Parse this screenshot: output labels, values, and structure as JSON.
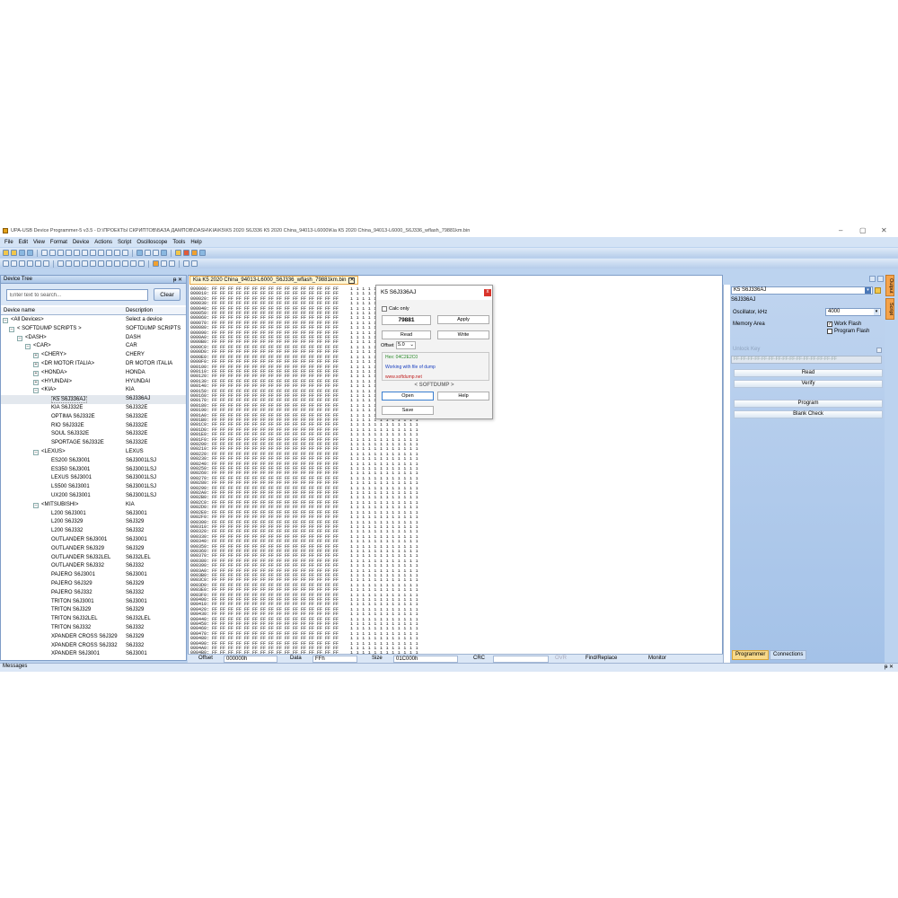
{
  "window": {
    "title": "UPA-USB Device Programmer-5 v3.5 - D:\\ПРОЕКТЫ СКРИПТОВ\\БАЗА ДАМПОВ\\DASH\\KIA\\K5\\K5 2020 S6J336 K5 2020 China_94013-L6000\\Kia K5 2020 China_94013-L6000_S6J336_wflash_79881km.bin",
    "minimize": "–",
    "maximize": "▢",
    "close": "✕"
  },
  "menu": [
    "File",
    "Edit",
    "View",
    "Format",
    "Device",
    "Actions",
    "Script",
    "Oscilloscope",
    "Tools",
    "Help"
  ],
  "device_tree": {
    "title": "Device Tree",
    "pin": "ᵽ ✕",
    "search_placeholder": "Enter text to search...",
    "clear_label": "Clear",
    "col_name": "Device name",
    "col_desc": "Description",
    "rows": [
      {
        "name": "<All Devices>",
        "desc": "Select a device",
        "expander": "–"
      },
      {
        "name": "< SOFTDUMP SCRIPTS >",
        "desc": "SOFTDUMP SCRIPTS",
        "expander": "–"
      },
      {
        "name": "<DASH>",
        "desc": "DASH",
        "expander": "–"
      },
      {
        "name": "<CAR>",
        "desc": "CAR",
        "expander": "–"
      },
      {
        "name": "<CHERY>",
        "desc": "CHERY",
        "expander": "+"
      },
      {
        "name": "<DR MOTOR ITALIA>",
        "desc": "DR MOTOR ITALIA",
        "expander": "+"
      },
      {
        "name": "<HONDA>",
        "desc": "HONDA",
        "expander": "+"
      },
      {
        "name": "<HYUNDAI>",
        "desc": "HYUNDAI",
        "expander": "+"
      },
      {
        "name": "<KIA>",
        "desc": "KIA",
        "expander": "–"
      },
      {
        "name": "K5 S6J336AJ",
        "desc": "S6J336AJ",
        "expander": ""
      },
      {
        "name": "KIA S6J332E",
        "desc": "S6J332E",
        "expander": ""
      },
      {
        "name": "OPTIMA S6J332E",
        "desc": "S6J332E",
        "expander": ""
      },
      {
        "name": "RIO S6J332E",
        "desc": "S6J332E",
        "expander": ""
      },
      {
        "name": "SOUL S6J332E",
        "desc": "S6J332E",
        "expander": ""
      },
      {
        "name": "SPORTAGE S6J332E",
        "desc": "S6J332E",
        "expander": ""
      },
      {
        "name": "<LEXUS>",
        "desc": "LEXUS",
        "expander": "–"
      },
      {
        "name": "ES200 S6J3001",
        "desc": "S6J3001LSJ",
        "expander": ""
      },
      {
        "name": "ES350 S6J3001",
        "desc": "S6J3001LSJ",
        "expander": ""
      },
      {
        "name": "LEXUS S6J3001",
        "desc": "S6J3001LSJ",
        "expander": ""
      },
      {
        "name": "LS500 S6J3001",
        "desc": "S6J3001LSJ",
        "expander": ""
      },
      {
        "name": "UX200 S6J3001",
        "desc": "S6J3001LSJ",
        "expander": ""
      },
      {
        "name": "<MITSUBISHI>",
        "desc": "KIA",
        "expander": "–"
      },
      {
        "name": "L200 S6J3001",
        "desc": "S6J3001",
        "expander": ""
      },
      {
        "name": "L200 S6J329",
        "desc": "S6J329",
        "expander": ""
      },
      {
        "name": "L200 S6J332",
        "desc": "S6J332",
        "expander": ""
      },
      {
        "name": "OUTLANDER S6J3001",
        "desc": "S6J3001",
        "expander": ""
      },
      {
        "name": "OUTLANDER S6J329",
        "desc": "S6J329",
        "expander": ""
      },
      {
        "name": "OUTLANDER S6J32LEL",
        "desc": "S6J32LEL",
        "expander": ""
      },
      {
        "name": "OUTLANDER S6J332",
        "desc": "S6J332",
        "expander": ""
      },
      {
        "name": "PAJERO S6J3001",
        "desc": "S6J3001",
        "expander": ""
      },
      {
        "name": "PAJERO S6J329",
        "desc": "S6J329",
        "expander": ""
      },
      {
        "name": "PAJERO S6J332",
        "desc": "S6J332",
        "expander": ""
      },
      {
        "name": "TRITON S6J3001",
        "desc": "S6J3001",
        "expander": ""
      },
      {
        "name": "TRITON S6J329",
        "desc": "S6J329",
        "expander": ""
      },
      {
        "name": "TRITON S6J32LEL",
        "desc": "S6J32LEL",
        "expander": ""
      },
      {
        "name": "TRITON S6J332",
        "desc": "S6J332",
        "expander": ""
      },
      {
        "name": "XPANDER CROSS S6J329",
        "desc": "S6J329",
        "expander": ""
      },
      {
        "name": "XPANDER CROSS S6J332",
        "desc": "S6J332",
        "expander": ""
      },
      {
        "name": "XPANDER S6J3001",
        "desc": "S6J3001",
        "expander": ""
      }
    ]
  },
  "hex_view": {
    "tab_label": "Kia K5 2020 China_94013-L6000_S6J336_wflash_79881km.bin",
    "tab_close": "✕",
    "fill_byte": "FF",
    "ascii_char": "ı"
  },
  "dialog": {
    "title": "K5 S6J336AJ",
    "close": "x",
    "calc_only": "Calc only",
    "value": "79881",
    "apply": "Apply",
    "read": "Read",
    "write": "Write",
    "offset_label": "Offset",
    "offset_value": "5.0",
    "hex_info": "Hex: 04C2E2C0",
    "working_info": "Working with file of dump",
    "url": "www.softdump.net",
    "brand": "< SOFTDUMP >",
    "open": "Open",
    "help": "Help",
    "save": "Save"
  },
  "status": {
    "offset_label": "Offset",
    "offset_value": "000000h",
    "data_label": "Data",
    "data_value": "FFh",
    "size_label": "Size",
    "size_value": "01C000h",
    "crc_label": "CRC",
    "crc_value": "",
    "ovr": "OVR",
    "find_replace": "Find/Replace",
    "monitor": "Monitor"
  },
  "programmer": {
    "device": "K5 S6J336AJ",
    "chip": "S6J336AJ",
    "oscillator_label": "Oscillator, kHz",
    "oscillator_value": "4000",
    "memory_area_label": "Memory Area",
    "work_flash": "Work Flash",
    "program_flash": "Program Flash",
    "unlock_key_label": "Unlock Key",
    "unlock_key_value": "FF-FF-FF-FF-FF-FF-FF-FF-FF-FF-FF-FF-FF-FF-FF",
    "read": "Read",
    "verify": "Verify",
    "program": "Program",
    "blank_check": "Blank Check",
    "tab_programmer": "Programmer",
    "tab_connections": "Connections"
  },
  "side_tabs": [
    "Output",
    "Script"
  ],
  "messages": {
    "label": "Messages",
    "pin": "ᵽ ✕"
  }
}
